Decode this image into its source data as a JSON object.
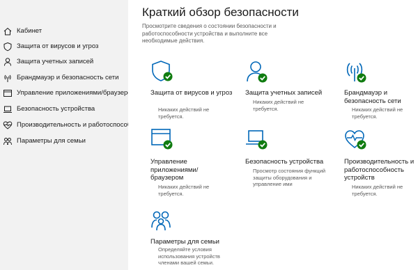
{
  "colors": {
    "accent": "#0067b8",
    "ok": "#107c10",
    "sidebar_bg": "#f2f2f2",
    "text": "#1a1a1a",
    "muted": "#5a5a5a"
  },
  "sidebar": {
    "items": [
      {
        "label": "Кабинет",
        "icon": "home-icon"
      },
      {
        "label": "Защита от вирусов и угроз",
        "icon": "shield-icon"
      },
      {
        "label": "Защита учетных записей",
        "icon": "person-icon"
      },
      {
        "label": "Брандмауэр и безопасность сети",
        "icon": "wifi-antenna-icon"
      },
      {
        "label": "Управление приложениями/браузером",
        "icon": "app-window-icon"
      },
      {
        "label": "Безопасность устройства",
        "icon": "laptop-icon"
      },
      {
        "label": "Производительность и работоспособн",
        "icon": "heart-pulse-icon"
      },
      {
        "label": "Параметры для семьи",
        "icon": "family-icon"
      }
    ]
  },
  "main": {
    "title": "Краткий обзор безопасности",
    "subtitle": "Просмотрите сведения о состоянии безопасности и работоспособности устройства и выполните все необходимые действия.",
    "tiles": [
      {
        "title": "Защита от вирусов и угроз",
        "status": "Никаких действий не требуется.",
        "icon": "shield-icon"
      },
      {
        "title": "Защита учетных записей",
        "status": "Никаких действий не требуется.",
        "icon": "person-icon"
      },
      {
        "title": "Брандмауэр и безопасность сети",
        "status": "Никаких действий не требуется.",
        "icon": "wifi-antenna-icon"
      },
      {
        "title": "Управление приложениями/ браузером",
        "status": "Никаких действий не требуется.",
        "icon": "app-window-icon"
      },
      {
        "title": "Безопасность устройства",
        "status": "Просмотр состояния функций защиты оборудования и управление ими",
        "icon": "laptop-icon"
      },
      {
        "title": "Производительность и работоспособность устройств",
        "status": "Никаких действий не требуется.",
        "icon": "heart-pulse-icon"
      },
      {
        "title": "Параметры для семьи",
        "status": "Определяйте условия использования устройств членами вашей семьи.",
        "icon": "family-icon"
      }
    ]
  }
}
